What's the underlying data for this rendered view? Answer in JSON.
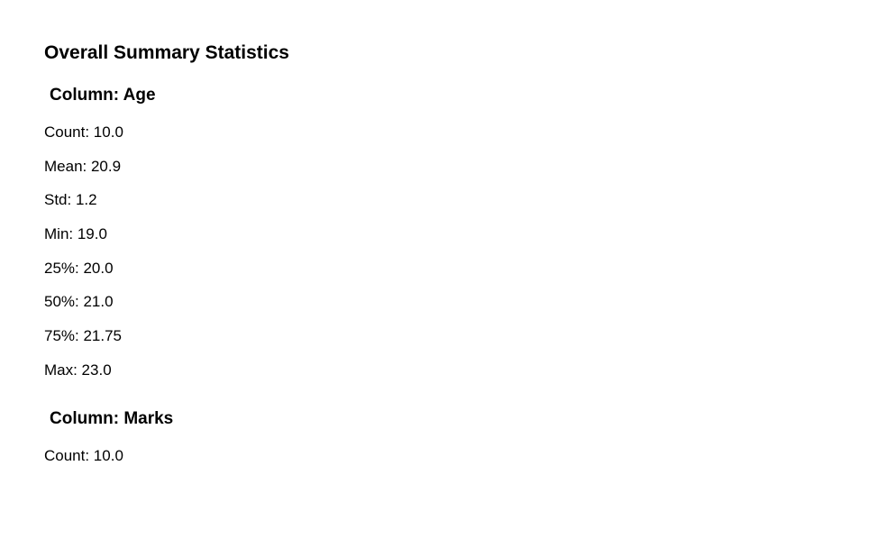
{
  "title": "Overall Summary Statistics",
  "columns": [
    {
      "heading": "Column: Age",
      "stats": [
        "Count: 10.0",
        "Mean: 20.9",
        "Std: 1.2",
        "Min: 19.0",
        "25%: 20.0",
        "50%: 21.0",
        "75%: 21.75",
        "Max: 23.0"
      ]
    },
    {
      "heading": "Column: Marks",
      "stats": [
        "Count: 10.0"
      ]
    }
  ]
}
